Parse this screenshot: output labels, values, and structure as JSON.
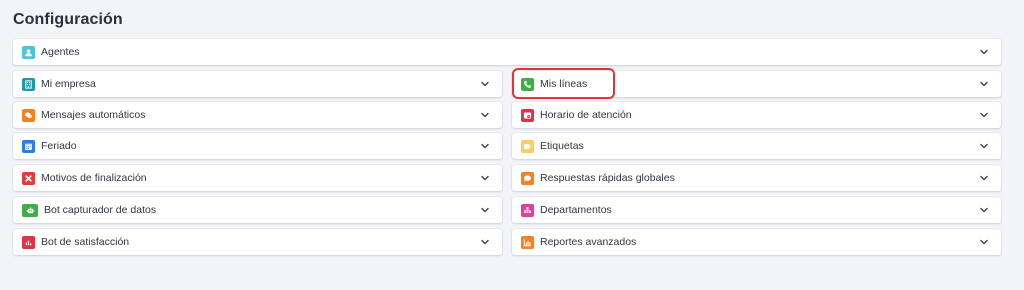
{
  "page": {
    "title": "Configuración"
  },
  "colors": {
    "teal": "#4fc3d9",
    "teal_dark": "#1e9aa8",
    "orange": "#f6821f",
    "blue": "#2b7de9",
    "red": "#e23c3c",
    "green": "#3cb043",
    "crimson": "#e0334a",
    "yellow": "#f7cf5e",
    "pink": "#e23f9a",
    "highlight": "#e53238"
  },
  "items": {
    "agentes": {
      "label": "Agentes",
      "icon": "user-icon"
    },
    "mi_empresa": {
      "label": "Mi empresa",
      "icon": "building-icon"
    },
    "mis_lineas": {
      "label": "Mis líneas",
      "icon": "phone-icon"
    },
    "mensajes_automaticos": {
      "label": "Mensajes automáticos",
      "icon": "chat-bubbles-icon"
    },
    "horario_atencion": {
      "label": "Horario de atención",
      "icon": "clock-icon"
    },
    "feriado": {
      "label": "Feriado",
      "icon": "calendar-icon"
    },
    "etiquetas": {
      "label": "Etiquetas",
      "icon": "tag-icon"
    },
    "motivos_finalizacion": {
      "label": "Motivos de finalización",
      "icon": "close-icon"
    },
    "respuestas_rapidas": {
      "label": "Respuestas rápidas globales",
      "icon": "speech-bubble-icon"
    },
    "bot_capturador": {
      "label": "Bot capturador de datos",
      "icon": "robot-icon"
    },
    "departamentos": {
      "label": "Departamentos",
      "icon": "org-chart-icon"
    },
    "bot_satisfaccion": {
      "label": "Bot de satisfacción",
      "icon": "bar-chart-icon"
    },
    "reportes_avanzados": {
      "label": "Reportes avanzados",
      "icon": "report-chart-icon"
    }
  }
}
